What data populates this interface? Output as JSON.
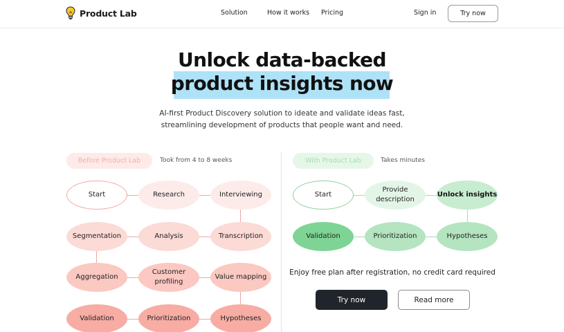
{
  "nav": {
    "brand": "Product Lab",
    "links": [
      "Solution",
      "How it works",
      "Pricing"
    ],
    "sign_in": "Sign in",
    "try_now": "Try now"
  },
  "hero": {
    "title_line1": "Unlock data-backed",
    "title_line2": "product insights now",
    "subtitle_line1": "AI-first Product Discovery solution to ideate and validate ideas fast,",
    "subtitle_line2": "streamlining development of products that people want and need.",
    "highlight_color": "#aee2f6"
  },
  "before": {
    "label": "Before Product Lab",
    "note": "Took from 4 to 8 weeks",
    "nodes": [
      {
        "text": "Start",
        "fill": "#ffffff",
        "stroke": "#f0aaa4"
      },
      {
        "text": "Research",
        "fill": "#fdebea"
      },
      {
        "text": "Interviewing",
        "fill": "#fdebea"
      },
      {
        "text": "Segmentation",
        "fill": "#fcdad6"
      },
      {
        "text": "Analysis",
        "fill": "#fcdad6"
      },
      {
        "text": "Transcription",
        "fill": "#fcdad6"
      },
      {
        "text": "Aggregation",
        "fill": "#fbc8c2"
      },
      {
        "text": "Customer profiling",
        "fill": "#fbc8c2"
      },
      {
        "text": "Value mapping",
        "fill": "#fbc8c2"
      },
      {
        "text": "Validation",
        "fill": "#f7aca4"
      },
      {
        "text": "Prioritization",
        "fill": "#f7aca4"
      },
      {
        "text": "Hypotheses",
        "fill": "#f7aca4"
      }
    ]
  },
  "with": {
    "label": "With Product Lab",
    "note": "Takes minutes",
    "nodes": [
      {
        "text": "Start",
        "fill": "#ffffff",
        "stroke": "#8fd0a0"
      },
      {
        "text": "Provide description",
        "fill": "#e3f5e7"
      },
      {
        "text": "Unlock insights",
        "fill": "#c7ecd0",
        "bold": true
      },
      {
        "text": "Validation",
        "fill": "#7ed495"
      },
      {
        "text": "Prioritization",
        "fill": "#b4e4c0"
      },
      {
        "text": "Hypotheses",
        "fill": "#b4e4c0"
      }
    ],
    "free_plan_text": "Enjoy free plan after registration, no credit card required",
    "try_now": "Try now",
    "read_more": "Read more"
  }
}
